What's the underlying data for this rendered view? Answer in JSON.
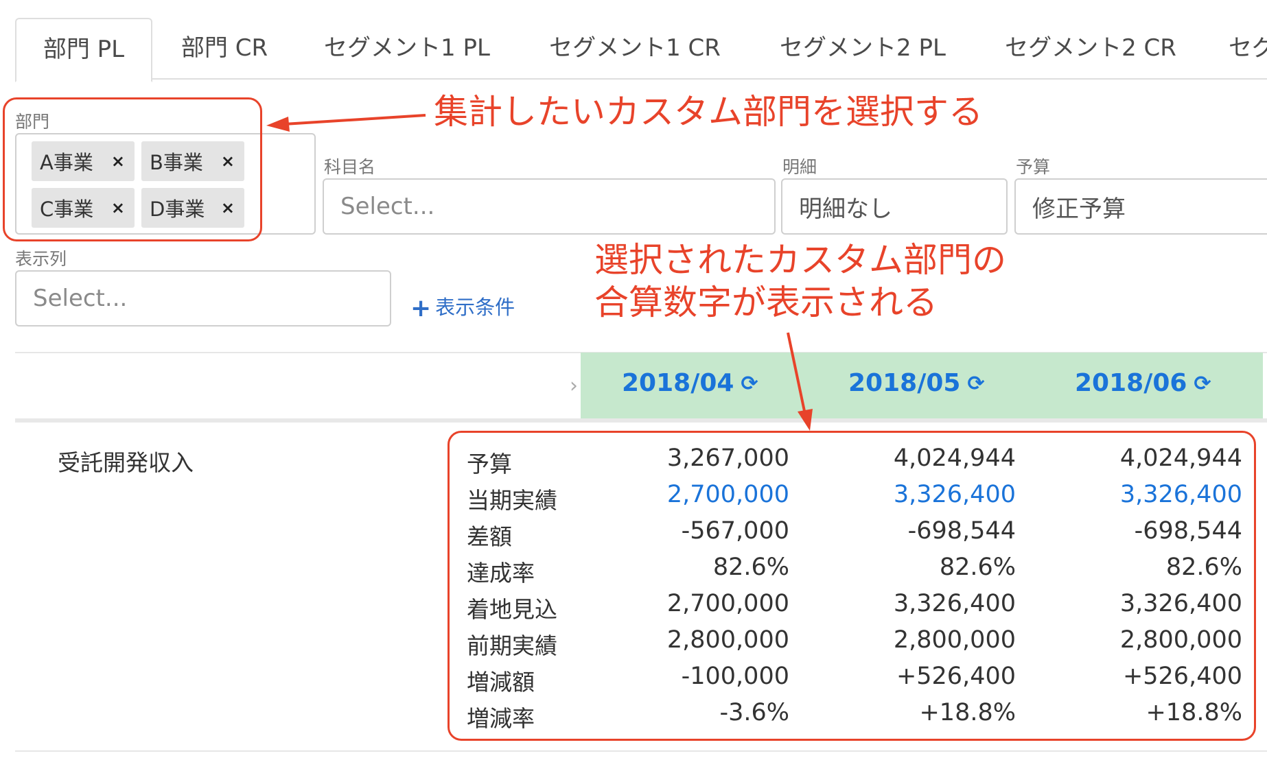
{
  "tabs": [
    "部門 PL",
    "部門 CR",
    "セグメント1 PL",
    "セグメント1 CR",
    "セグメント2 PL",
    "セグメント2 CR",
    "セグ"
  ],
  "filters": {
    "department": {
      "label": "部門",
      "chips": [
        "A事業",
        "B事業",
        "C事業",
        "D事業"
      ],
      "remove_glyph": "×"
    },
    "account": {
      "label": "科目名",
      "placeholder": "Select..."
    },
    "detail": {
      "label": "明細",
      "value": "明細なし"
    },
    "budget": {
      "label": "予算",
      "value": "修正予算"
    },
    "columns": {
      "label": "表示列",
      "placeholder": "Select..."
    },
    "add_condition": {
      "icon": "plus-icon",
      "label": "表示条件"
    }
  },
  "annotations": {
    "top": "集計したいカスタム部門を選択する",
    "middle_line1": "選択されたカスタム部門の",
    "middle_line2": "合算数字が表示される"
  },
  "table": {
    "refresh_icon": "refresh-icon",
    "months": [
      "2018/04",
      "2018/05",
      "2018/06"
    ],
    "account_name": "受託開発収入",
    "rows": [
      {
        "label": "予算",
        "values": [
          "3,267,000",
          "4,024,944",
          "4,024,944"
        ],
        "highlight": false
      },
      {
        "label": "当期実績",
        "values": [
          "2,700,000",
          "3,326,400",
          "3,326,400"
        ],
        "highlight": true
      },
      {
        "label": "差額",
        "values": [
          "-567,000",
          "-698,544",
          "-698,544"
        ],
        "highlight": false
      },
      {
        "label": "達成率",
        "values": [
          "82.6%",
          "82.6%",
          "82.6%"
        ],
        "highlight": false
      },
      {
        "label": "着地見込",
        "values": [
          "2,700,000",
          "3,326,400",
          "3,326,400"
        ],
        "highlight": false
      },
      {
        "label": "前期実績",
        "values": [
          "2,800,000",
          "2,800,000",
          "2,800,000"
        ],
        "highlight": false
      },
      {
        "label": "増減額",
        "values": [
          "-100,000",
          "+526,400",
          "+526,400"
        ],
        "highlight": false
      },
      {
        "label": "増減率",
        "values": [
          "-3.6%",
          "+18.8%",
          "+18.8%"
        ],
        "highlight": false
      }
    ]
  },
  "colors": {
    "accent_blue": "#1a73d9",
    "annotation_red": "#e8432a",
    "header_band": "#c6e8cd"
  }
}
